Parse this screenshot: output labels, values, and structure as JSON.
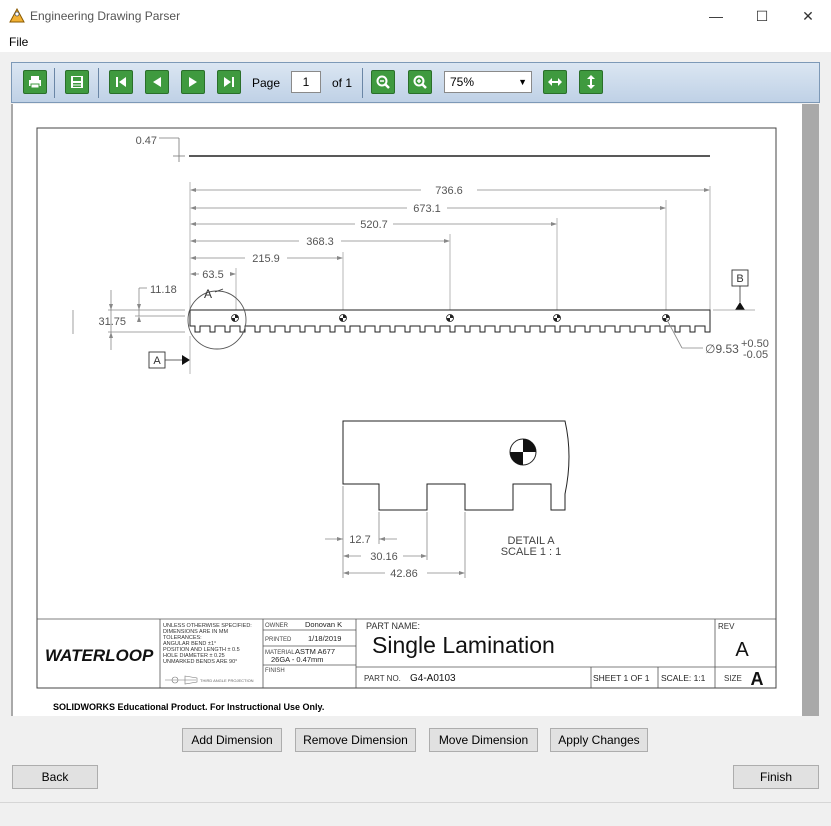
{
  "window": {
    "title": "Engineering Drawing Parser",
    "minimize": "—",
    "maximize": "☐",
    "close": "✕"
  },
  "menu": {
    "file": "File"
  },
  "toolbar": {
    "page_label": "Page",
    "page_value": "1",
    "of_label": "of 1",
    "zoom": "75%",
    "icons": [
      "print-icon",
      "save-icon",
      "first-page-icon",
      "prev-page-icon",
      "next-page-icon",
      "last-page-icon",
      "zoom-out-icon",
      "zoom-in-icon",
      "fit-width-icon",
      "fit-height-icon"
    ]
  },
  "drawing": {
    "thickness": "0.47",
    "dims": [
      "736.6",
      "673.1",
      "520.7",
      "368.3",
      "215.9",
      "63.5"
    ],
    "height_dim": "11.18",
    "width_dim": "31.75",
    "datum_a": "A",
    "datum_b": "B",
    "detail_marker": "A",
    "hole_dia": "∅9.53",
    "tol_plus": "+0.50",
    "tol_minus": "-0.05",
    "detail_dims": [
      "12.7",
      "30.16",
      "42.86"
    ],
    "detail_title": "DETAIL A",
    "detail_scale": "SCALE 1 : 1"
  },
  "title_block": {
    "logo": "WATERLOOP",
    "notes": [
      "UNLESS OTHERWISE SPECIFIED:",
      "DIMENSIONS ARE IN MM",
      "TOLERANCES:",
      "ANGULAR BEND ±1°",
      "POSITION AND LENGTH ± 0.5",
      "HOLE DIAMETER ± 0.25",
      "UNMARKED BENDS ARE 90°"
    ],
    "projection": "THIRD ANGLE PROJECTION",
    "owner_label": "OWNER",
    "owner": "Donovan K",
    "printed_label": "PRINTED",
    "printed": "1/18/2019",
    "material_label": "MATERIAL",
    "material": "ASTM A677",
    "material2": "26GA - 0.47mm",
    "finish_label": "FINISH",
    "part_name_label": "PART NAME:",
    "part_name": "Single Lamination",
    "rev_label": "REV",
    "rev": "A",
    "part_no_label": "PART NO.",
    "part_no": "G4-A0103",
    "sheet": "SHEET 1 OF 1",
    "scale": "SCALE: 1:1",
    "size_label": "SIZE",
    "size": "A"
  },
  "edu_note": "SOLIDWORKS Educational Product. For Instructional Use Only.",
  "actions": {
    "add": "Add Dimension",
    "remove": "Remove Dimension",
    "move": "Move Dimension",
    "apply": "Apply Changes",
    "back": "Back",
    "finish": "Finish"
  }
}
